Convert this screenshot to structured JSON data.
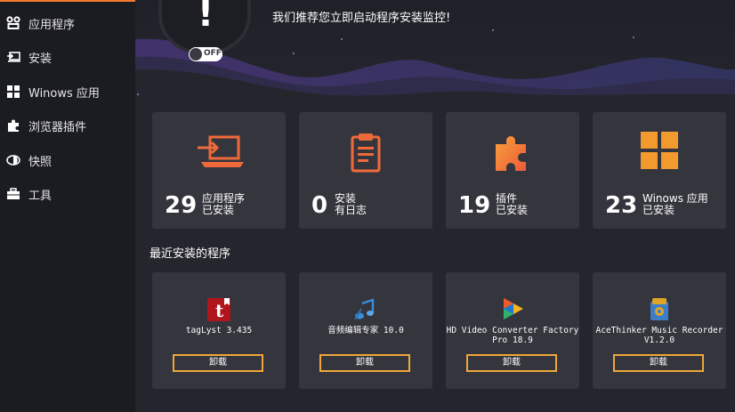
{
  "colors": {
    "accent": "#f07a2e",
    "button_border": "#f0a63a",
    "sidebar_bg": "#1b1c21",
    "main_bg": "#25262d",
    "card_bg": "#34353d"
  },
  "sidebar": {
    "items": [
      {
        "icon": "apps-icon",
        "label": "应用程序"
      },
      {
        "icon": "install-icon",
        "label": "安装"
      },
      {
        "icon": "windows-icon",
        "label": "Winows 应用"
      },
      {
        "icon": "puzzle-icon",
        "label": "浏览器插件"
      },
      {
        "icon": "snapshot-icon",
        "label": "快照"
      },
      {
        "icon": "toolbox-icon",
        "label": "工具"
      }
    ]
  },
  "banner": {
    "alert_symbol": "!",
    "toggle_label": "OFF",
    "message": "我们推荐您立即启动程序安装监控!"
  },
  "stats": [
    {
      "icon": "laptop-import-icon",
      "count": "29",
      "line1": "应用程序",
      "line2": "已安装"
    },
    {
      "icon": "clipboard-log-icon",
      "count": "0",
      "line1": "安装",
      "line2": "有日志"
    },
    {
      "icon": "puzzle-plugin-icon",
      "count": "19",
      "line1": "插件",
      "line2": "已安装"
    },
    {
      "icon": "windows-tiles-icon",
      "count": "23",
      "line1": "Winows 应用",
      "line2": "已安装"
    }
  ],
  "recent": {
    "title": "最近安装的程序",
    "apps": [
      {
        "icon": "taglyst-icon",
        "name": "tagLyst 3.435",
        "button": "卸载"
      },
      {
        "icon": "audio-editor-icon",
        "name": "音频编辑专家 10.0",
        "button": "卸载"
      },
      {
        "icon": "hd-video-converter-icon",
        "name": "HD Video Converter Factory Pro 18.9",
        "button": "卸载"
      },
      {
        "icon": "acethinker-recorder-icon",
        "name": "AceThinker Music Recorder V1.2.0",
        "button": "卸载"
      }
    ]
  }
}
